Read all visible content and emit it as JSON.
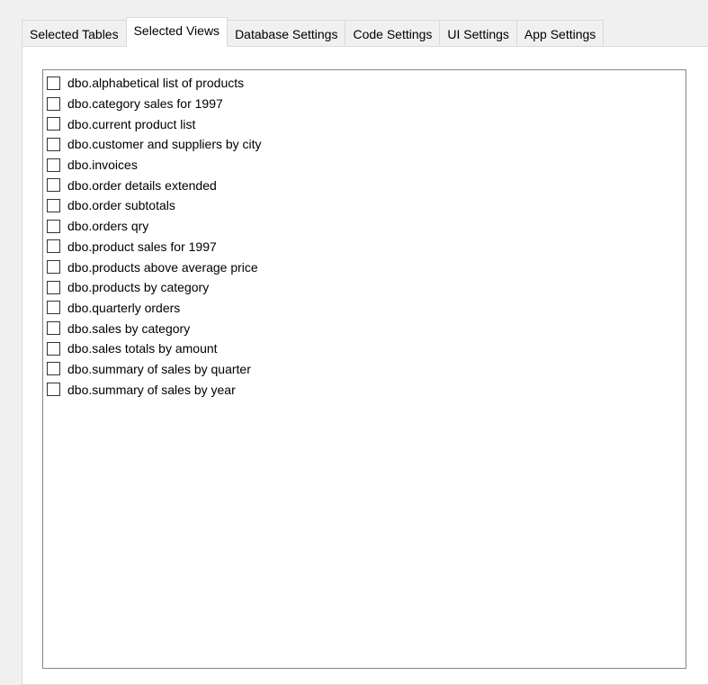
{
  "tabs": [
    {
      "label": "Selected Tables",
      "active": false
    },
    {
      "label": "Selected Views",
      "active": true
    },
    {
      "label": "Database Settings",
      "active": false
    },
    {
      "label": "Code Settings",
      "active": false
    },
    {
      "label": "UI Settings",
      "active": false
    },
    {
      "label": "App Settings",
      "active": false
    }
  ],
  "views_list": {
    "items": [
      {
        "label": "dbo.alphabetical list of products",
        "checked": false
      },
      {
        "label": "dbo.category sales for 1997",
        "checked": false
      },
      {
        "label": "dbo.current product list",
        "checked": false
      },
      {
        "label": "dbo.customer and suppliers by city",
        "checked": false
      },
      {
        "label": "dbo.invoices",
        "checked": false
      },
      {
        "label": "dbo.order details extended",
        "checked": false
      },
      {
        "label": "dbo.order subtotals",
        "checked": false
      },
      {
        "label": "dbo.orders qry",
        "checked": false
      },
      {
        "label": "dbo.product sales for 1997",
        "checked": false
      },
      {
        "label": "dbo.products above average price",
        "checked": false
      },
      {
        "label": "dbo.products by category",
        "checked": false
      },
      {
        "label": "dbo.quarterly orders",
        "checked": false
      },
      {
        "label": "dbo.sales by category",
        "checked": false
      },
      {
        "label": "dbo.sales totals by amount",
        "checked": false
      },
      {
        "label": "dbo.summary of sales by quarter",
        "checked": false
      },
      {
        "label": "dbo.summary of sales by year",
        "checked": false
      }
    ]
  }
}
